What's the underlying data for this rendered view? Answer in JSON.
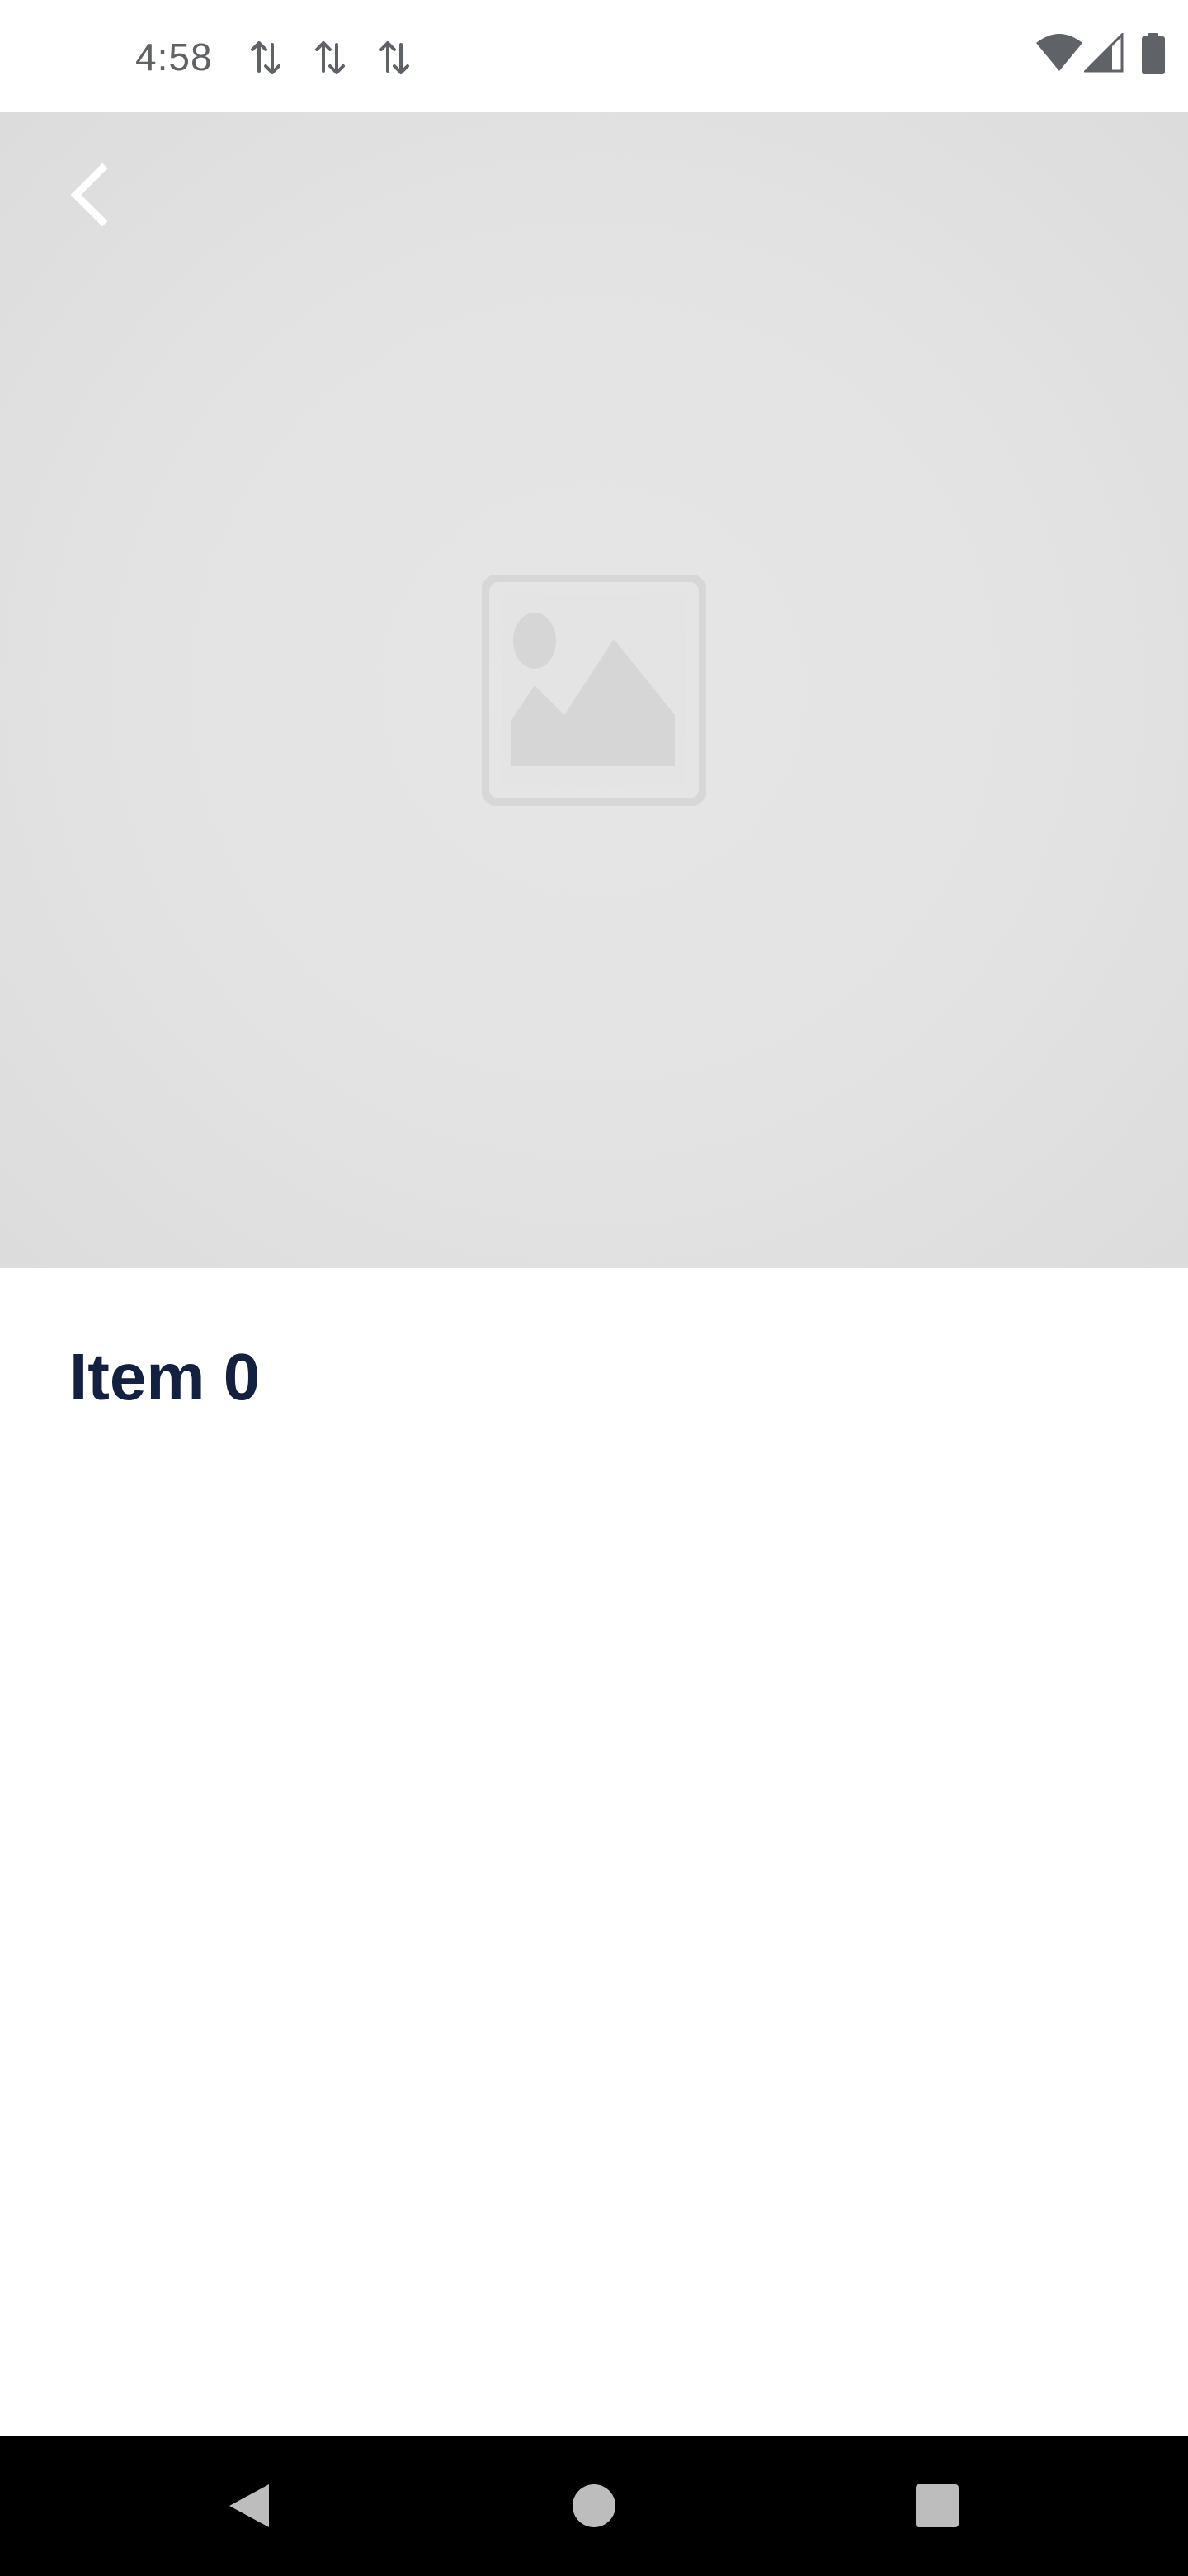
{
  "status_bar": {
    "time": "4:58",
    "sync_icons": [
      "sync-arrows-icon",
      "sync-arrows-icon",
      "sync-arrows-icon"
    ],
    "right_icons": [
      "wifi-icon",
      "cell-signal-icon",
      "battery-icon"
    ]
  },
  "hero": {
    "back_icon": "chevron-left-icon",
    "placeholder_icon": "image-placeholder-icon",
    "background_color": "#e3e3e3"
  },
  "detail": {
    "title": "Item 0",
    "title_color": "#13203f"
  },
  "nav_bar": {
    "buttons": [
      "back-triangle-icon",
      "home-circle-icon",
      "recents-square-icon"
    ],
    "background_color": "#000000"
  }
}
